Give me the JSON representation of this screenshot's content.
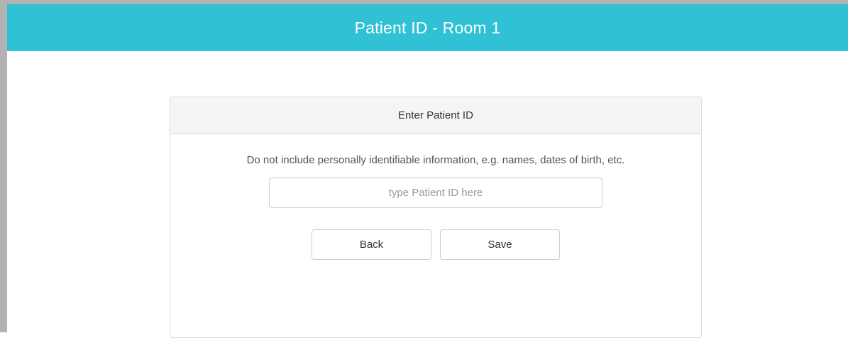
{
  "header": {
    "title": "Patient ID - Room 1"
  },
  "card": {
    "title": "Enter Patient ID",
    "notice": "Do not include personally identifiable information, e.g. names, dates of birth, etc.",
    "input": {
      "value": "",
      "placeholder": "type Patient ID here"
    },
    "buttons": {
      "back_label": "Back",
      "save_label": "Save"
    }
  },
  "colors": {
    "header_bg": "#31c1d4",
    "header_text": "#ffffff",
    "window_border": "#b3b3b3"
  }
}
